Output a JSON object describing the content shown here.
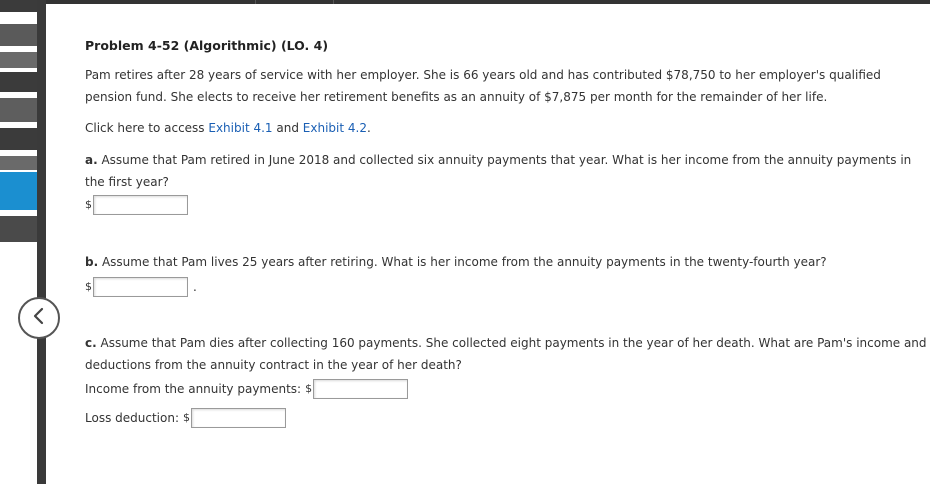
{
  "problem": {
    "title": "Problem 4-52 (Algorithmic) (LO. 4)",
    "intro": "Pam retires after 28 years of service with her employer. She is 66 years old and has contributed $78,750 to her employer's qualified pension fund. She elects to receive her retirement benefits as an annuity of $7,875 per month for the remainder of her life.",
    "access_prefix": "Click here to access ",
    "exhibit1": "Exhibit 4.1",
    "access_and": " and ",
    "exhibit2": "Exhibit 4.2",
    "access_suffix": "."
  },
  "part_a": {
    "letter": "a.",
    "question": " Assume that Pam retired in June 2018 and collected six annuity payments that year. What is her income from the annuity payments in the first year?",
    "currency": "$",
    "value": ""
  },
  "part_b": {
    "letter": "b.",
    "question": " Assume that Pam lives 25 years after retiring. What is her income from the annuity payments in the twenty-fourth year?",
    "currency": "$",
    "value": "",
    "suffix": "."
  },
  "part_c": {
    "letter": "c.",
    "question": " Assume that Pam dies after collecting 160 payments. She collected eight payments in the year of her death. What are Pam's income and deductions from the annuity contract in the year of her death?",
    "income_label": "Income from the annuity payments:",
    "loss_label": "Loss deduction:",
    "currency": "$",
    "income_value": "",
    "loss_value": ""
  },
  "nav": {
    "back_icon": "chevron-left-icon"
  }
}
